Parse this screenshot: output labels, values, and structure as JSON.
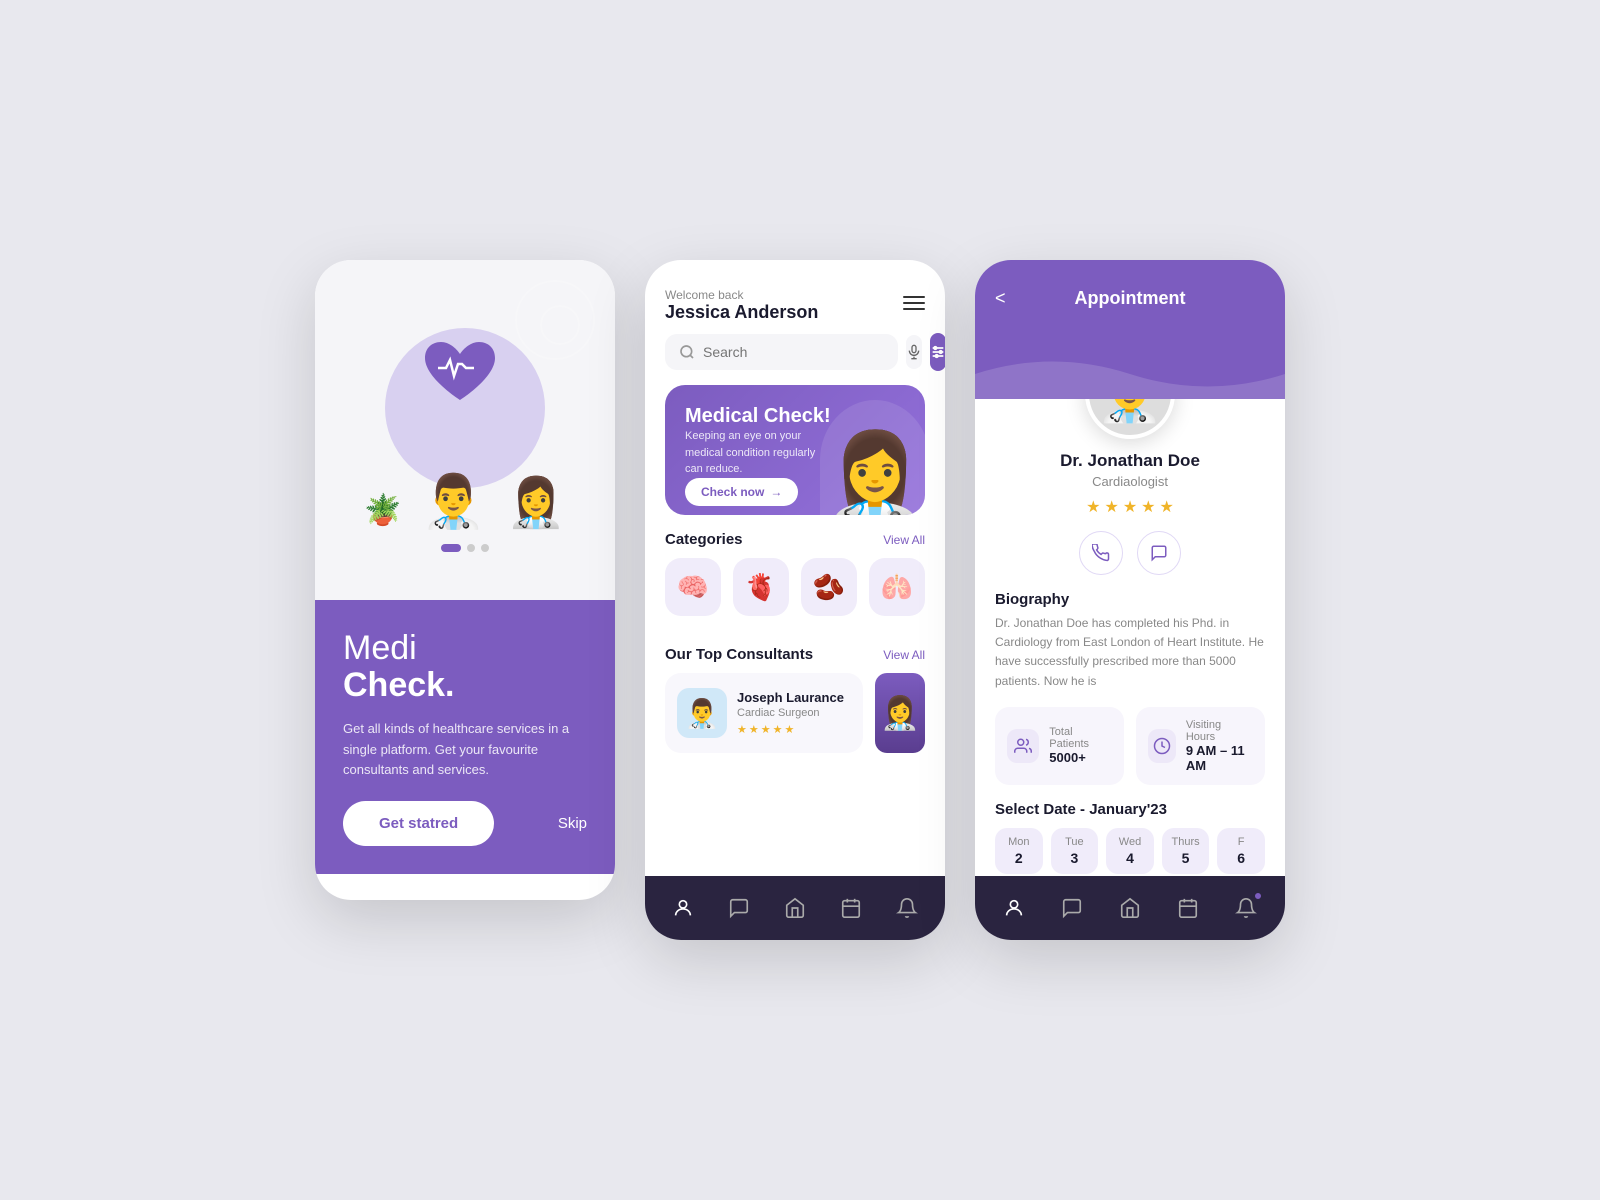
{
  "screen1": {
    "title_light": "Medi",
    "title_bold": "Check.",
    "subtitle": "Get all kinds of healthcare services in a single platform. Get your favourite consultants and services.",
    "get_started_label": "Get statred",
    "skip_label": "Skip",
    "dots": [
      "active",
      "inactive",
      "inactive"
    ]
  },
  "screen2": {
    "welcome": "Welcome back",
    "name": "Jessica Anderson",
    "search_placeholder": "Search",
    "banner": {
      "title": "Medical Check!",
      "subtitle": "Keeping an eye on your medical condition regularly can reduce.",
      "cta": "Check now"
    },
    "categories_title": "Categories",
    "categories_view_all": "View All",
    "categories": [
      {
        "icon": "🧠",
        "label": "Brain"
      },
      {
        "icon": "🫀",
        "label": "Heart"
      },
      {
        "icon": "🫘",
        "label": "Kidney"
      },
      {
        "icon": "🫁",
        "label": "Lungs"
      }
    ],
    "consultants_title": "Our Top Consultants",
    "consultants_view_all": "View All",
    "consultants": [
      {
        "name": "Joseph Laurance",
        "specialty": "Cardiac Surgeon",
        "stars": 5
      }
    ],
    "nav_items": [
      "profile",
      "chat",
      "home",
      "calendar",
      "bell"
    ]
  },
  "screen3": {
    "title": "Appointment",
    "back_label": "<",
    "doctor": {
      "name": "Dr. Jonathan Doe",
      "specialty": "Cardiaologist",
      "stars": 5,
      "bio": "Dr. Jonathan Doe has completed his Phd. in Cardiology from East London of Heart Institute. He have successfully prescribed more than 5000 patients. Now he is",
      "total_patients_label": "Total Patients",
      "total_patients_value": "5000+",
      "visiting_hours_label": "Visiting Hours",
      "visiting_hours_value": "9 AM – 11 AM"
    },
    "select_date_title": "Select Date - January'23",
    "dates": [
      {
        "day": "Mon",
        "num": ""
      },
      {
        "day": "Tue",
        "num": ""
      },
      {
        "day": "Wed",
        "num": ""
      },
      {
        "day": "Thurs",
        "num": ""
      }
    ],
    "nav_items": [
      "profile",
      "chat",
      "home",
      "calendar",
      "bell"
    ],
    "biography_title": "Biography"
  }
}
